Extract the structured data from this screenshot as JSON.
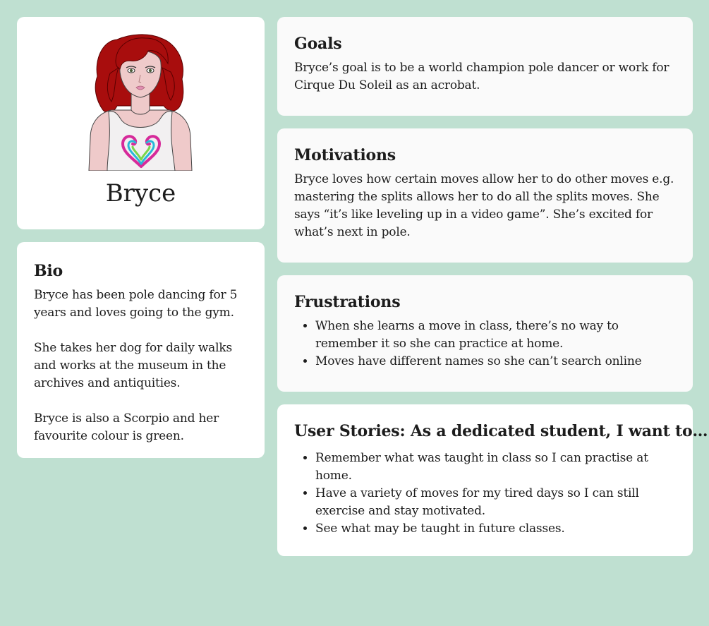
{
  "persona": {
    "name": "Bryce"
  },
  "bio": {
    "title": "Bio",
    "paragraphs": [
      "Bryce has been pole dancing for 5 years and loves going to the gym.",
      "She takes her dog for daily walks and works at the museum in the archives and antiquities.",
      "Bryce is also a Scorpio and her favourite colour is green."
    ]
  },
  "goals": {
    "title": "Goals",
    "text": "Bryce’s goal is to be a world champion pole dancer or work for Cirque Du Soleil as an acrobat."
  },
  "motivations": {
    "title": "Motivations",
    "text": "Bryce loves how certain moves allow her to do other moves e.g. mastering the splits allows her to do all the splits moves. She says “it’s like leveling up in a video game”. She’s excited for what’s next in pole."
  },
  "frustrations": {
    "title": "Frustrations",
    "items": [
      "When she learns a move in class, there’s no way to remember it so she can practice at home.",
      "Moves have different names so she can’t search online"
    ]
  },
  "user_stories": {
    "title": "User Stories: As a dedicated student, I want to…",
    "items": [
      "Remember what was taught in class so I can practise at home.",
      "Have a variety of moves for my tired days so I can still exercise and stay motivated.",
      "See what may be taught in future classes."
    ]
  },
  "colors": {
    "background": "#bfe0d1",
    "card_white": "#ffffff",
    "card_grey": "#fafafa",
    "hair": "#a80d0d",
    "skin": "#efcaca"
  },
  "icons": {
    "avatar": "woman-avatar-icon",
    "shirt_emblem": "heart-icon"
  }
}
